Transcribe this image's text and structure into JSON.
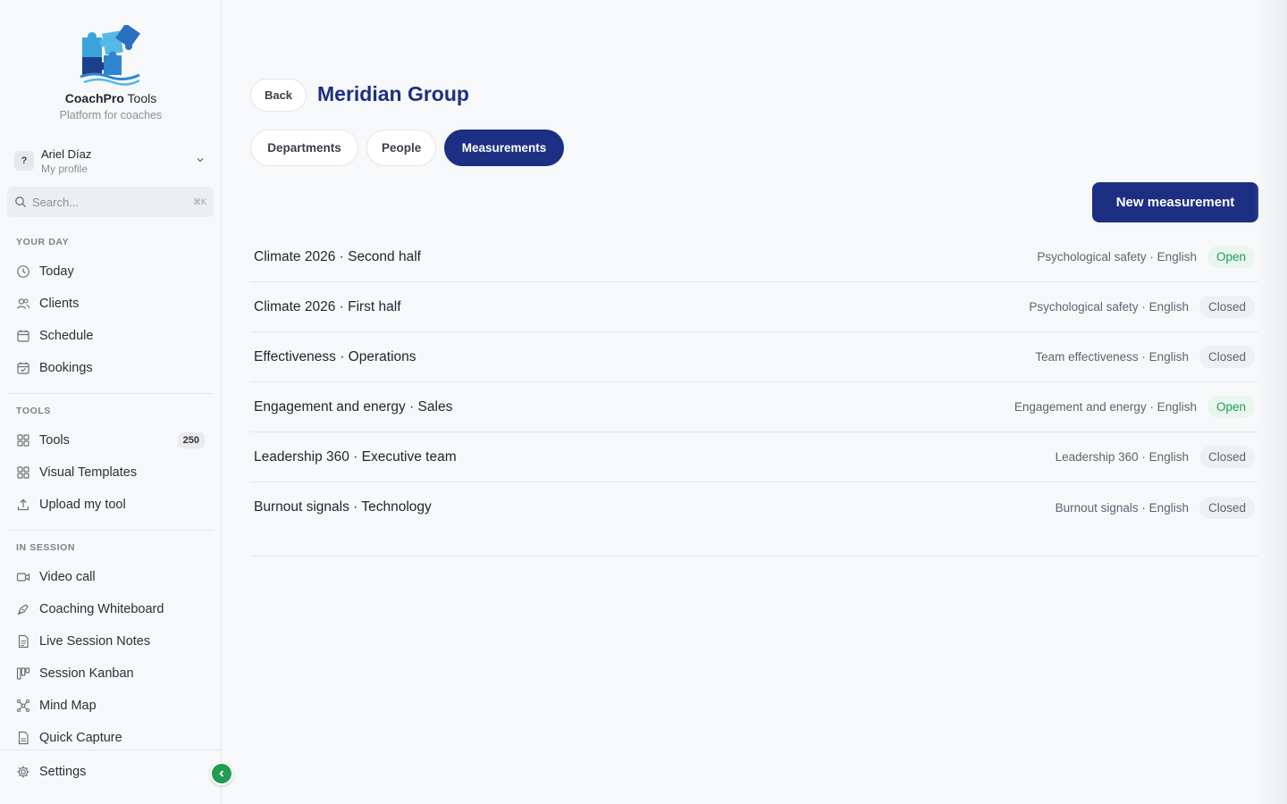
{
  "brand": {
    "name_bold": "CoachPro",
    "name_rest": " Tools",
    "tagline": "Platform for coaches"
  },
  "profile": {
    "avatar": "?",
    "name": "Ariel Díaz",
    "subtitle": "My profile"
  },
  "search": {
    "placeholder": "Search...",
    "shortcut": "⌘K"
  },
  "sections": {
    "your_day": "YOUR DAY",
    "tools": "TOOLS",
    "in_session": "IN SESSION"
  },
  "nav": {
    "today": "Today",
    "clients": "Clients",
    "schedule": "Schedule",
    "bookings": "Bookings",
    "tools": "Tools",
    "tools_count": "250",
    "visual_templates": "Visual Templates",
    "upload_tool": "Upload my tool",
    "video_call": "Video call",
    "whiteboard": "Coaching Whiteboard",
    "notes": "Live Session Notes",
    "kanban": "Session Kanban",
    "mind_map": "Mind Map",
    "quick_capture": "Quick Capture",
    "settings": "Settings"
  },
  "header": {
    "back": "Back",
    "title": "Meridian Group"
  },
  "tabs": {
    "departments": "Departments",
    "people": "People",
    "measurements": "Measurements"
  },
  "actions": {
    "new_measurement": "New measurement"
  },
  "colors": {
    "brand_navy": "#1d2f82",
    "open_green": "#1f9d55"
  },
  "measurements": [
    {
      "title": "Climate 2026 · Second half",
      "meta": "Psychological safety · English",
      "status": "Open"
    },
    {
      "title": "Climate 2026 · First half",
      "meta": "Psychological safety · English",
      "status": "Closed"
    },
    {
      "title": "Effectiveness · Operations",
      "meta": "Team effectiveness · English",
      "status": "Closed"
    },
    {
      "title": "Engagement and energy · Sales",
      "meta": "Engagement and energy · English",
      "status": "Open"
    },
    {
      "title": "Leadership 360 · Executive team",
      "meta": "Leadership 360 · English",
      "status": "Closed"
    },
    {
      "title": "Burnout signals · Technology",
      "meta": "Burnout signals · English",
      "status": "Closed"
    }
  ]
}
